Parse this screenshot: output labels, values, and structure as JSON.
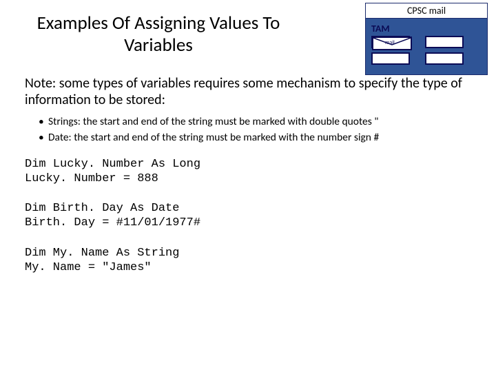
{
  "header": {
    "title": "Examples Of Assigning Values To Variables"
  },
  "rightbox": {
    "cpsc": "CPSC mail",
    "tam": "TAM",
    "mail": "mail"
  },
  "note": "Note: some types of variables requires some mechanism to specify the type of information to be stored:",
  "bullets": {
    "b1": "Strings: the start and end of the string must be marked with double quotes \"",
    "b2": "Date: the start and end of the string must be marked with the number sign #"
  },
  "code": {
    "block1": "Dim Lucky. Number As Long\nLucky. Number = 888",
    "block2": "Dim Birth. Day As Date\nBirth. Day = #11/01/1977#",
    "block3": "Dim My. Name As String\nMy. Name = \"James\""
  }
}
